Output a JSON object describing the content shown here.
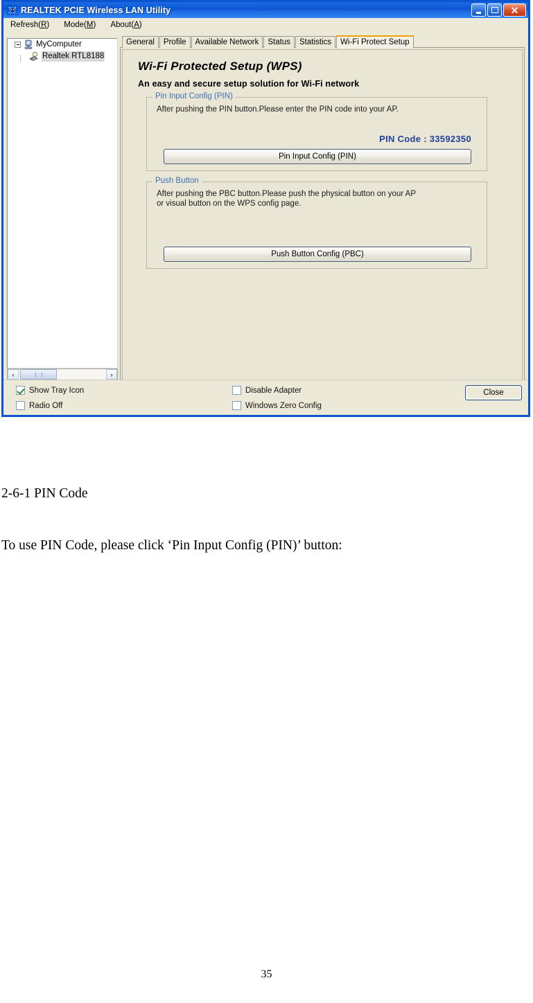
{
  "window": {
    "title": "REALTEK PCIE Wireless LAN Utility",
    "icon": "realtek-logo-icon",
    "controls": {
      "minimize": "minimize-button",
      "maximize": "maximize-button",
      "close": "close-window-button"
    }
  },
  "menu": {
    "items": [
      {
        "label": "Refresh(R)",
        "text": "Refresh(",
        "accel": "R",
        "tail": ")"
      },
      {
        "label": "Mode(M)",
        "text": "Mode(",
        "accel": "M",
        "tail": ")"
      },
      {
        "label": "About(A)",
        "text": "About(",
        "accel": "A",
        "tail": ")"
      }
    ]
  },
  "tree": {
    "root": "MyComputer",
    "child": "Realtek RTL8188"
  },
  "scrollbar": {
    "left_arrow": "‹",
    "right_arrow": "›"
  },
  "tabs": [
    {
      "label": "General",
      "active": false
    },
    {
      "label": "Profile",
      "active": false
    },
    {
      "label": "Available Network",
      "active": false
    },
    {
      "label": "Status",
      "active": false
    },
    {
      "label": "Statistics",
      "active": false
    },
    {
      "label": "Wi-Fi Protect Setup",
      "active": true
    }
  ],
  "wps": {
    "title": "Wi-Fi Protected Setup (WPS)",
    "subtitle": "An easy and secure setup solution for Wi-Fi network",
    "pin_group": {
      "legend": "Pin Input Config (PIN)",
      "description": "After pushing the PIN button.Please enter the PIN code into your AP.",
      "pin_label": "PIN Code :",
      "pin_value": "33592350",
      "pin_code_line": "PIN Code :  33592350",
      "button": "Pin Input Config (PIN)"
    },
    "pbc_group": {
      "legend": "Push Button",
      "description_line1": "After pushing the PBC button.Please push the physical button on your AP",
      "description_line2": "or visual button on the WPS config page.",
      "button": "Push Button Config (PBC)"
    }
  },
  "bottom": {
    "checkboxes": [
      {
        "label": "Show Tray Icon",
        "checked": true
      },
      {
        "label": "Radio Off",
        "checked": false
      },
      {
        "label": "Disable Adapter",
        "checked": false
      },
      {
        "label": "Windows Zero Config",
        "checked": false
      }
    ],
    "close_button": "Close"
  },
  "document": {
    "heading": "2-6-1 PIN Code",
    "paragraph": "To use PIN Code, please click ‘Pin Input Config (PIN)’ button:",
    "page_number": "35"
  },
  "colors": {
    "titlebar_blue": "#0b55d2",
    "window_border": "#0a54cf",
    "panel_beige": "#e9e6d6",
    "chrome_beige": "#ece9d8",
    "active_tab_orange": "#f0a000",
    "legend_blue": "#3f6fb5",
    "pin_blue": "#24409c",
    "check_green": "#2e8b2e"
  }
}
